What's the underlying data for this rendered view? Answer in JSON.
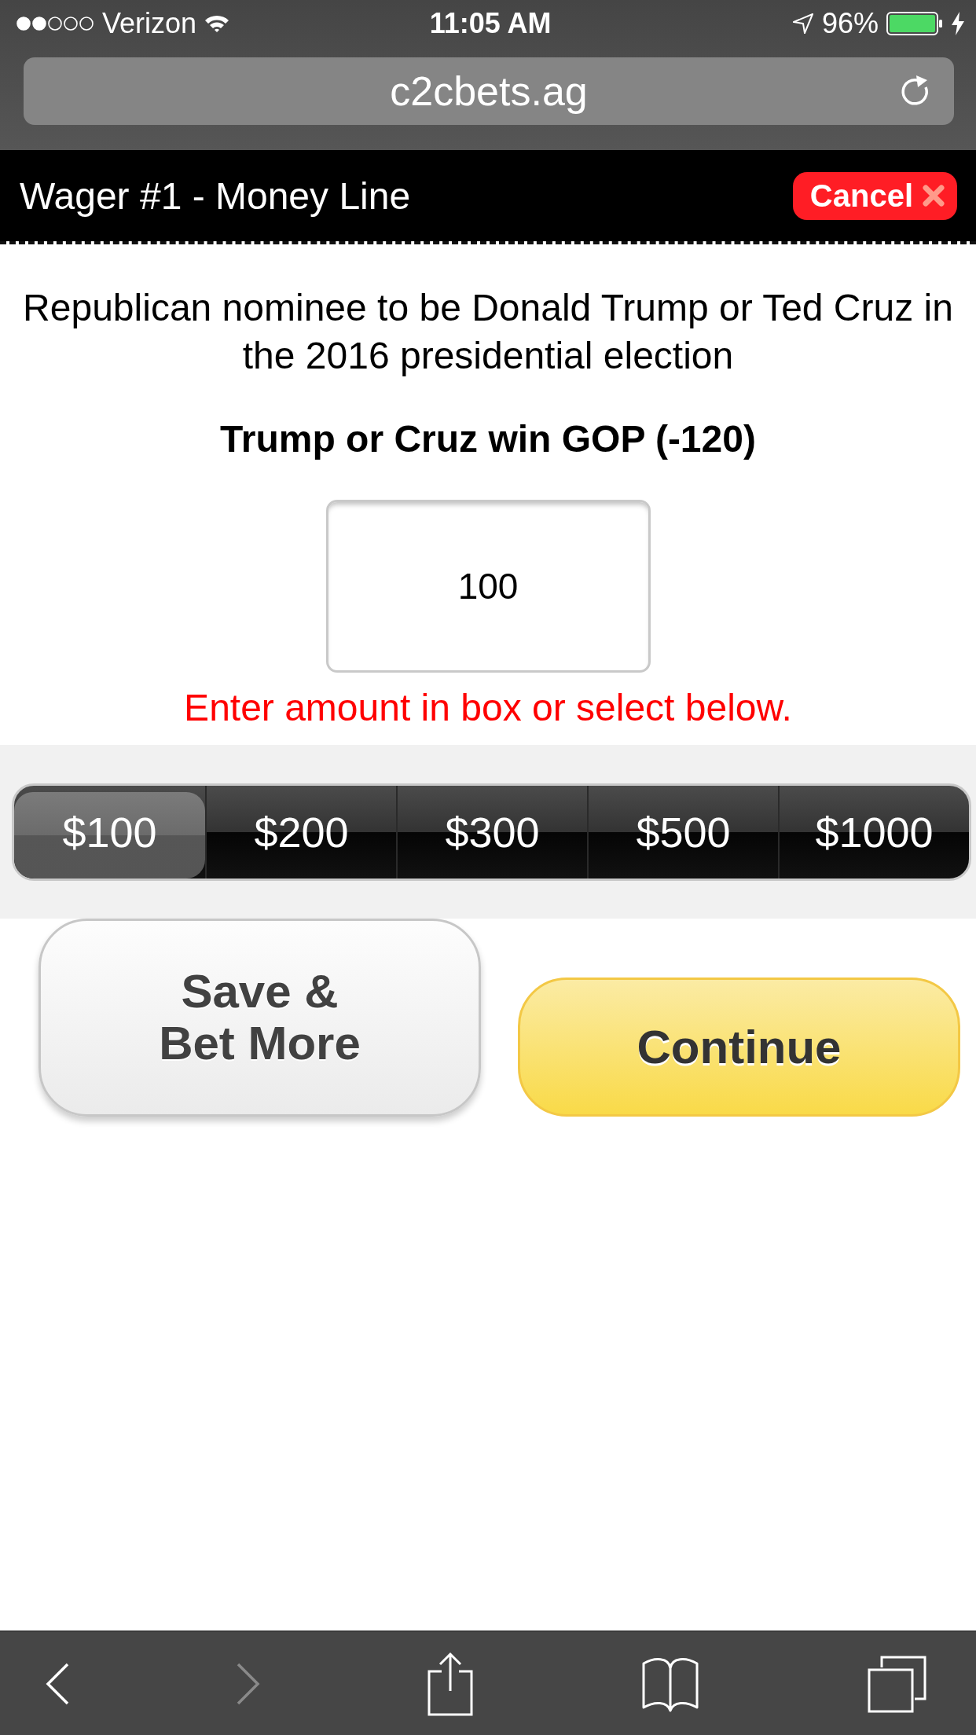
{
  "status_bar": {
    "carrier": "Verizon",
    "time": "11:05 AM",
    "battery": "96%"
  },
  "address_bar": {
    "url": "c2cbets.ag"
  },
  "header": {
    "title": "Wager #1 - Money Line",
    "cancel_button": "Cancel"
  },
  "wager": {
    "description": "Republican nominee to be Donald Trump or Ted Cruz in the 2016 presidential election",
    "selection": "Trump or Cruz win GOP (-120)",
    "amount": "100",
    "hint": "Enter amount in box or select below."
  },
  "amount_options": [
    {
      "label": "$100",
      "selected": true
    },
    {
      "label": "$200",
      "selected": false
    },
    {
      "label": "$300",
      "selected": false
    },
    {
      "label": "$500",
      "selected": false
    },
    {
      "label": "$1000",
      "selected": false
    }
  ],
  "buttons": [
    {
      "label": "Save &\nBet More",
      "kind": "secondary"
    },
    {
      "label": "Continue",
      "kind": "primary"
    }
  ],
  "toolbar": {
    "back_disabled": false,
    "forward_disabled": true
  }
}
